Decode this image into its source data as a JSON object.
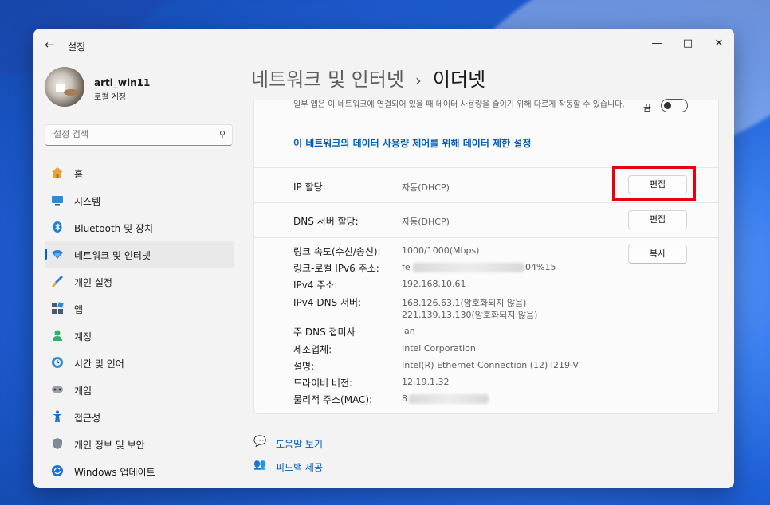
{
  "window": {
    "title": "설정"
  },
  "profile": {
    "name": "arti_win11",
    "account_type": "로컬 계정"
  },
  "search": {
    "placeholder": "설정 검색"
  },
  "sidebar": {
    "items": [
      {
        "label": "홈",
        "icon": "home-icon"
      },
      {
        "label": "시스템",
        "icon": "system-icon"
      },
      {
        "label": "Bluetooth 및 장치",
        "icon": "bluetooth-icon"
      },
      {
        "label": "네트워크 및 인터넷",
        "icon": "wifi-icon",
        "active": true
      },
      {
        "label": "개인 설정",
        "icon": "brush-icon"
      },
      {
        "label": "앱",
        "icon": "apps-icon"
      },
      {
        "label": "계정",
        "icon": "account-icon"
      },
      {
        "label": "시간 및 언어",
        "icon": "globe-clock-icon"
      },
      {
        "label": "게임",
        "icon": "gamepad-icon"
      },
      {
        "label": "접근성",
        "icon": "accessibility-icon"
      },
      {
        "label": "개인 정보 및 보안",
        "icon": "shield-icon"
      },
      {
        "label": "Windows 업데이트",
        "icon": "update-icon"
      }
    ]
  },
  "breadcrumb": {
    "parent": "네트워크 및 인터넷",
    "separator": "›",
    "current": "이더넷"
  },
  "metered": {
    "description": "일부 앱은 이 네트워크에 연결되어 있을 때 데이터 사용량을 줄이기 위해 다르게 작동할 수 있습니다.",
    "toggle_label": "끔",
    "toggle_on": false,
    "link": "이 네트워크의 데이터 사용량 제어를 위해 데이터 제한 설정"
  },
  "ip_assignment": {
    "label": "IP 할당:",
    "value": "자동(DHCP)",
    "button": "편집"
  },
  "dns_assignment": {
    "label": "DNS 서버 할당:",
    "value": "자동(DHCP)",
    "button": "편집"
  },
  "properties": {
    "copy_button": "복사",
    "rows": [
      {
        "label": "링크 속도(수신/송신):",
        "value": "1000/1000(Mbps)"
      },
      {
        "label": "링크-로컬 IPv6 주소:",
        "value_prefix": "fe",
        "value_suffix": "04%15"
      },
      {
        "label": "IPv4 주소:",
        "value": "192.168.10.61"
      },
      {
        "label": "IPv4 DNS 서버:",
        "value": "168.126.63.1(암호화되지 않음)",
        "value2": "221.139.13.130(암호화되지 않음)"
      },
      {
        "label": "주 DNS 접미사",
        "value": "lan"
      },
      {
        "label": "제조업체:",
        "value": "Intel Corporation"
      },
      {
        "label": "설명:",
        "value": "Intel(R) Ethernet Connection (12) I219-V"
      },
      {
        "label": "드라이버 버전:",
        "value": "12.19.1.32"
      },
      {
        "label": "물리적 주소(MAC):",
        "value_prefix": "8"
      }
    ]
  },
  "footer": {
    "help": "도움말 보기",
    "feedback": "피드백 제공"
  },
  "colors": {
    "accent": "#0067c0",
    "link": "#005fb8",
    "highlight": "#e8000b"
  }
}
